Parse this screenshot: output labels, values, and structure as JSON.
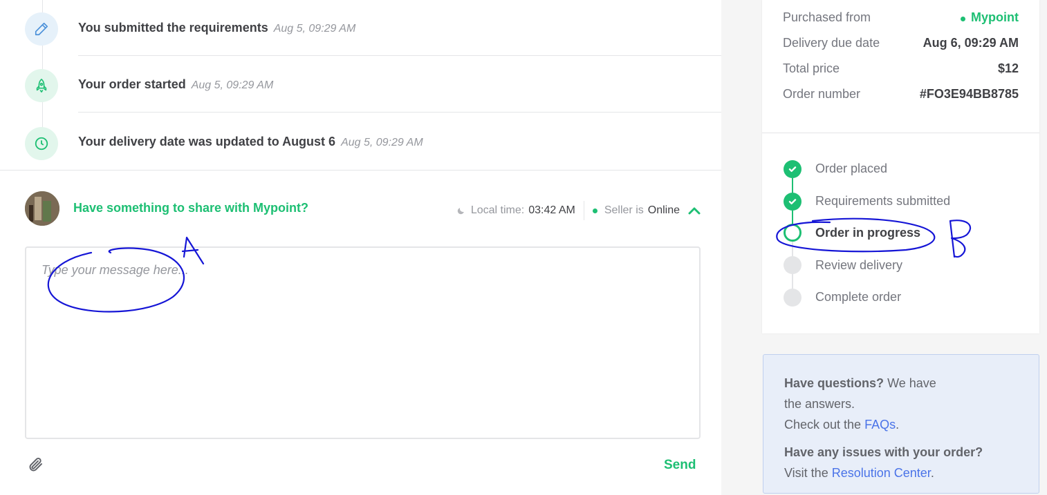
{
  "timeline": {
    "items": [
      {
        "text": "You submitted the requirements",
        "time": "Aug 5, 09:29 AM",
        "icon": "pencil-icon"
      },
      {
        "text": "Your order started",
        "time": "Aug 5, 09:29 AM",
        "icon": "rocket-icon"
      },
      {
        "text": "Your delivery date was updated to August 6",
        "time": "Aug 5, 09:29 AM",
        "icon": "clock-icon"
      }
    ]
  },
  "share": {
    "title": "Have something to share with Mypoint?",
    "local_time_label": "Local time:",
    "local_time_value": "03:42 AM",
    "seller_label": "Seller is",
    "seller_status": "Online",
    "placeholder": "Type your message here...",
    "send_label": "Send"
  },
  "order": {
    "rows": [
      {
        "label": "Purchased from",
        "value": "Mypoint"
      },
      {
        "label": "Delivery due date",
        "value": "Aug 6, 09:29 AM"
      },
      {
        "label": "Total price",
        "value": "$12"
      },
      {
        "label": "Order number",
        "value": "#FO3E94BB8785"
      }
    ],
    "steps": [
      {
        "label": "Order placed",
        "state": "done"
      },
      {
        "label": "Requirements submitted",
        "state": "done"
      },
      {
        "label": "Order in progress",
        "state": "current"
      },
      {
        "label": "Review delivery",
        "state": "todo"
      },
      {
        "label": "Complete order",
        "state": "todo"
      }
    ]
  },
  "help": {
    "q1_bold": "Have questions?",
    "q1_rest_a": "We have",
    "q1_rest_b": "the answers.",
    "faq_prefix": "Check out the",
    "faq_link": "FAQs",
    "faq_suffix": ".",
    "q2_bold": "Have any issues with your order?",
    "rc_prefix": "Visit the",
    "rc_link": "Resolution Center",
    "rc_suffix": "."
  },
  "annotations": {
    "label_a": "A",
    "label_b": "B"
  },
  "colors": {
    "brand_green": "#1dbf73",
    "link_blue": "#4a73e8",
    "ink_blue": "#1515d6",
    "icon_blue_bg": "#e6f1fa",
    "icon_green_bg": "#e2f6ec"
  }
}
